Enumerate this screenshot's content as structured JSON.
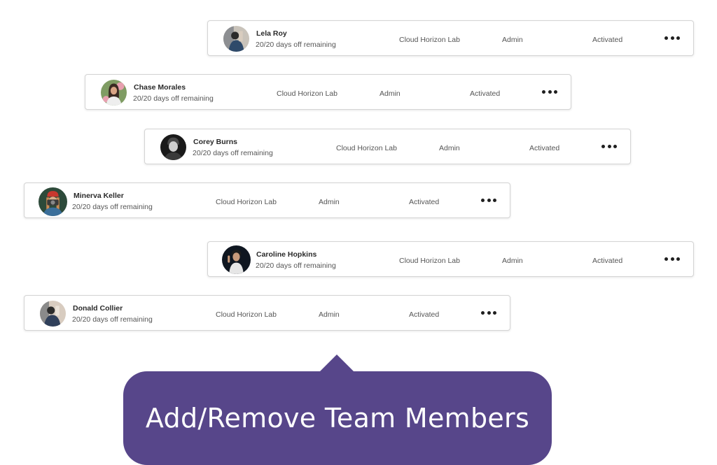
{
  "members": [
    {
      "name": "Lela Roy",
      "days_off": "20/20 days off remaining",
      "organization": "Cloud Horizon Lab",
      "role": "Admin",
      "status": "Activated",
      "avatar": "person-photo-avatar",
      "avatar_colors": [
        "#6a7a8c",
        "#2f3f5a",
        "#c9b8a5"
      ]
    },
    {
      "name": "Chase Morales",
      "days_off": "20/20 days off remaining",
      "organization": "Cloud Horizon Lab",
      "role": "Admin",
      "status": "Activated",
      "avatar": "person-photo-avatar",
      "avatar_colors": [
        "#7a9a5a",
        "#e8a0b0",
        "#3a2a22"
      ]
    },
    {
      "name": "Corey Burns",
      "days_off": "20/20 days off remaining",
      "organization": "Cloud Horizon Lab",
      "role": "Admin",
      "status": "Activated",
      "avatar": "person-photo-avatar",
      "avatar_colors": [
        "#1a1a1a",
        "#cfcfcf",
        "#3a3a3a"
      ]
    },
    {
      "name": "Minerva Keller",
      "days_off": "20/20 days off remaining",
      "organization": "Cloud Horizon Lab",
      "role": "Admin",
      "status": "Activated",
      "avatar": "person-photo-avatar",
      "avatar_colors": [
        "#2d4a3a",
        "#c8382e",
        "#d9b08c"
      ]
    },
    {
      "name": "Caroline Hopkins",
      "days_off": "20/20 days off remaining",
      "organization": "Cloud Horizon Lab",
      "role": "Admin",
      "status": "Activated",
      "avatar": "person-photo-avatar",
      "avatar_colors": [
        "#0f1620",
        "#e6e6e6",
        "#c89a7a"
      ]
    },
    {
      "name": "Donald Collier",
      "days_off": "20/20 days off remaining",
      "organization": "Cloud Horizon Lab",
      "role": "Admin",
      "status": "Activated",
      "avatar": "person-photo-avatar",
      "avatar_colors": [
        "#8a8a8a",
        "#2f3f5a",
        "#d8ccc0"
      ]
    }
  ],
  "more_menu_icon": "more-horizontal-icon",
  "callout": {
    "text": "Add/Remove Team Members",
    "color": "#57468a"
  }
}
